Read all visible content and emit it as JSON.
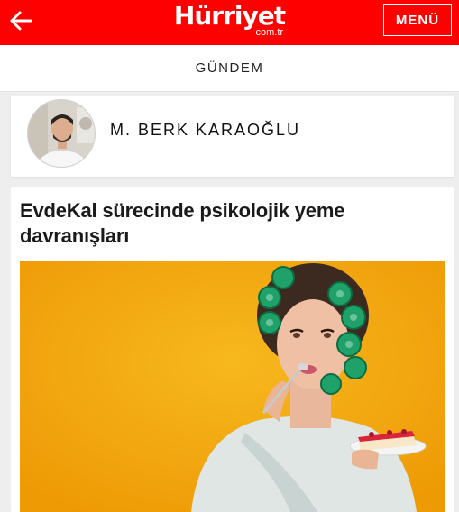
{
  "header": {
    "logo_text": "Hürriyet",
    "logo_sub": "com.tr",
    "menu_label": "MENÜ",
    "back_icon": "arrow-left-icon",
    "background_color": "#ff0000"
  },
  "section": {
    "title": "GÜNDEM"
  },
  "author": {
    "name": "M. BERK KARAOĞLU"
  },
  "article": {
    "title": "EvdeKal sürecinde psikolojik yeme davranışları"
  }
}
